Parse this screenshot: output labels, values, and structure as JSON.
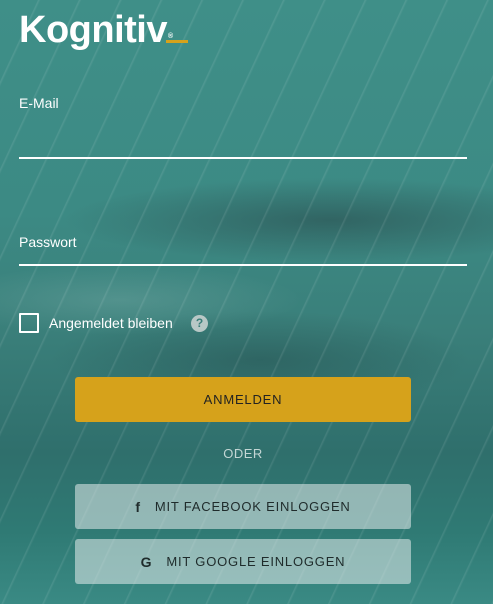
{
  "brand": {
    "name": "Kognitiv",
    "registered_mark": "®",
    "accent_color": "#d6a21b"
  },
  "form": {
    "email_label": "E-Mail",
    "email_value": "",
    "password_label": "Passwort",
    "password_value": "",
    "remember_label": "Angemeldet bleiben",
    "remember_checked": false,
    "help_icon_glyph": "?",
    "submit_label": "ANMELDEN",
    "or_label": "ODER"
  },
  "social": {
    "facebook_label": "MIT FACEBOOK EINLOGGEN",
    "facebook_icon": "facebook-icon",
    "facebook_glyph": "f",
    "google_label": "MIT GOOGLE EINLOGGEN",
    "google_icon": "google-icon",
    "google_glyph": "G"
  }
}
